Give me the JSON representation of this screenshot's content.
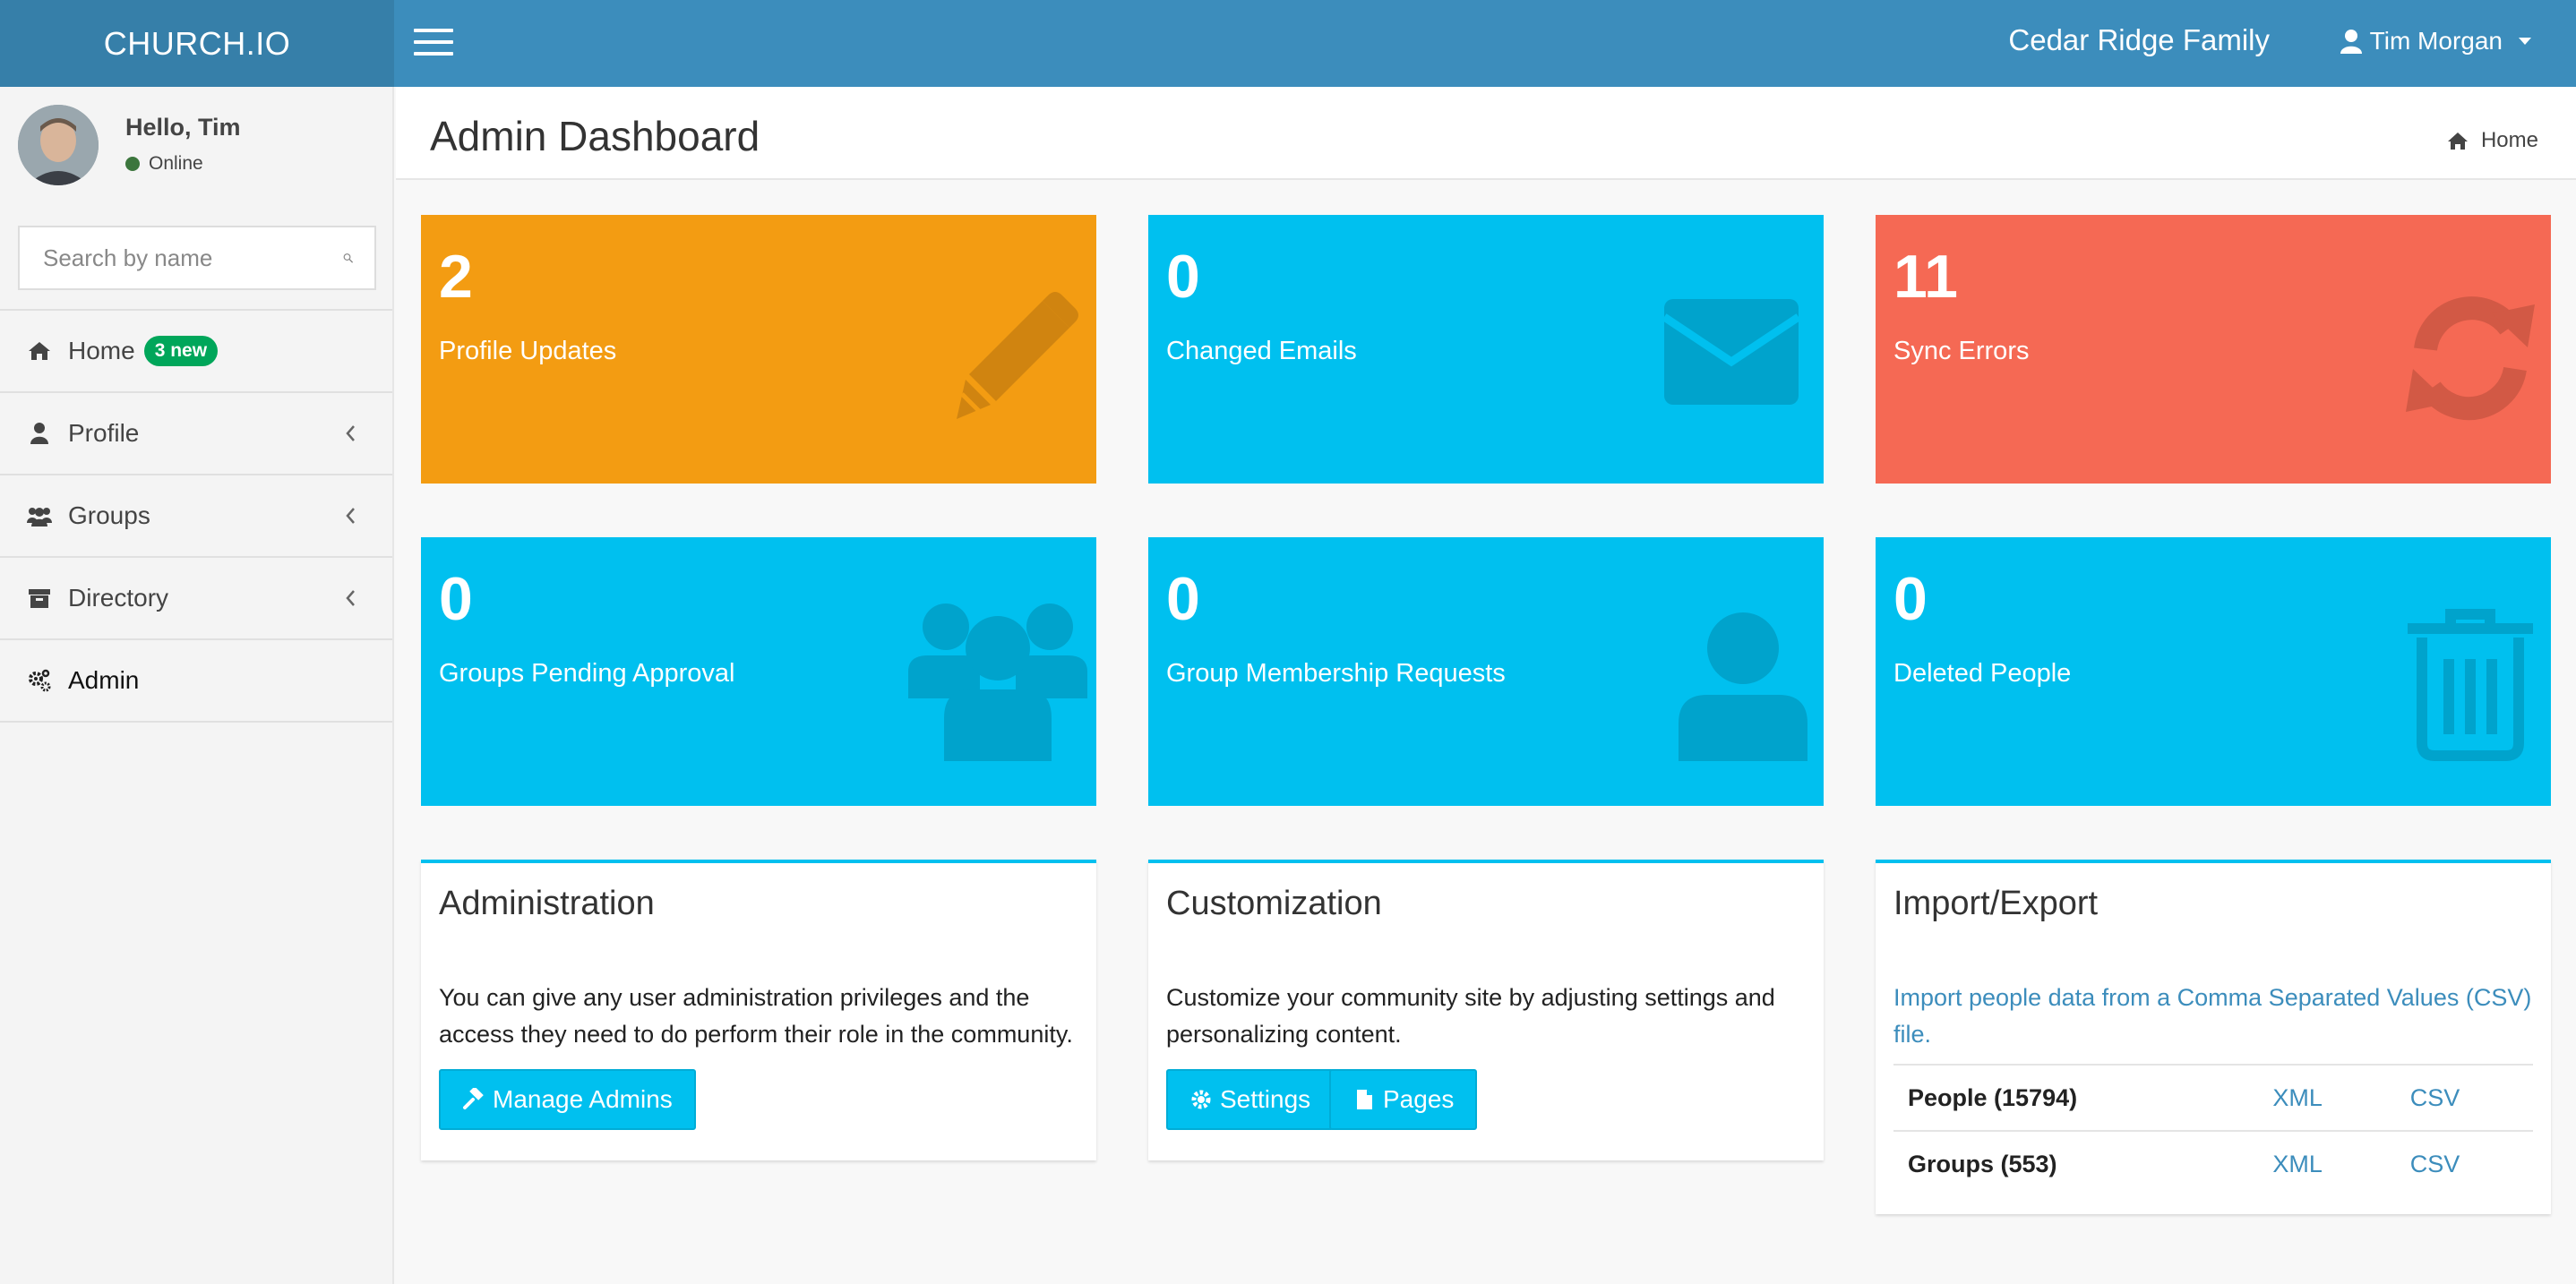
{
  "header": {
    "logo": "CHURCH.IO",
    "site_name": "Cedar Ridge Family",
    "user_name": "Tim Morgan"
  },
  "sidebar": {
    "greeting": "Hello, Tim",
    "status": "Online",
    "search_placeholder": "Search by name",
    "items": [
      {
        "label": "Home",
        "badge": "3 new",
        "icon": "home-icon"
      },
      {
        "label": "Profile",
        "icon": "user-icon"
      },
      {
        "label": "Groups",
        "icon": "users-icon"
      },
      {
        "label": "Directory",
        "icon": "archive-icon"
      },
      {
        "label": "Admin",
        "icon": "gears-icon"
      }
    ]
  },
  "page": {
    "title": "Admin Dashboard",
    "breadcrumb": "Home"
  },
  "stats": [
    {
      "value": "2",
      "label": "Profile Updates",
      "color": "#f39c12",
      "icon": "pencil-icon"
    },
    {
      "value": "0",
      "label": "Changed Emails",
      "color": "#00c0ef",
      "icon": "envelope-icon"
    },
    {
      "value": "11",
      "label": "Sync Errors",
      "color": "#f56954",
      "icon": "refresh-icon"
    },
    {
      "value": "0",
      "label": "Groups Pending Approval",
      "color": "#00c0ef",
      "icon": "users-icon"
    },
    {
      "value": "0",
      "label": "Group Membership Requests",
      "color": "#00c0ef",
      "icon": "user-icon"
    },
    {
      "value": "0",
      "label": "Deleted People",
      "color": "#00c0ef",
      "icon": "trash-icon"
    }
  ],
  "administration": {
    "title": "Administration",
    "text": "You can give any user administration privileges and the access they need to do perform their role in the community.",
    "button": "Manage Admins"
  },
  "customization": {
    "title": "Customization",
    "text": "Customize your community site by adjusting settings and personalizing content.",
    "settings_button": "Settings",
    "pages_button": "Pages"
  },
  "import_export": {
    "title": "Import/Export",
    "link": "Import people data from a Comma Separated Values (CSV) file.",
    "rows": [
      {
        "label": "People (15794)",
        "xml": "XML",
        "csv": "CSV"
      },
      {
        "label": "Groups (553)",
        "xml": "XML",
        "csv": "CSV"
      }
    ]
  }
}
